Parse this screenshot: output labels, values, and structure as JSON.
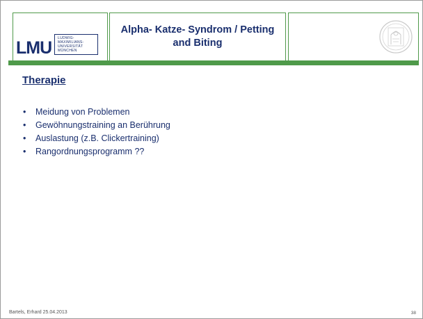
{
  "header": {
    "logo": {
      "letters": "LMU",
      "university_lines": [
        "LUDWIG-",
        "MAXIMILIANS-",
        "UNIVERSITÄT",
        "MÜNCHEN"
      ]
    },
    "title": "Alpha- Katze- Syndrom / Petting and Biting",
    "seal_icon": "university-seal-icon"
  },
  "main": {
    "section_title": "Therapie",
    "bullets": [
      "Meidung von Problemen",
      "Gewöhnungstraining an Berührung",
      "Auslastung (z.B. Clickertraining)",
      "Rangordnungsprogramm ??"
    ]
  },
  "footer": {
    "author_date": "Bartels, Erhard 25.04.2013",
    "page_number": "38"
  },
  "colors": {
    "accent_green": "#4f9a4a",
    "text_navy": "#1a2f6e"
  }
}
